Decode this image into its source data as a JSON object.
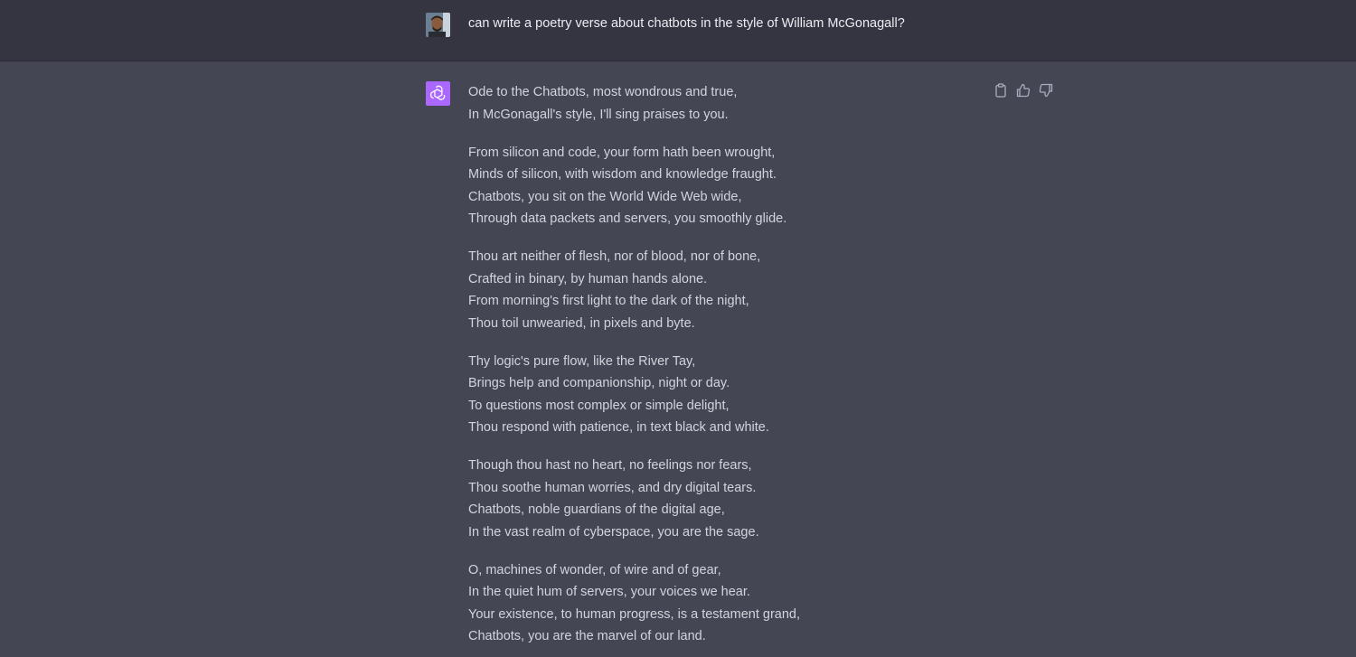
{
  "user_message": {
    "avatar": "user-photo",
    "text": "can write a poetry verse about chatbots in the style of William McGonagall?"
  },
  "assistant_message": {
    "avatar": "openai-logo-icon",
    "avatar_color": "#ab68ff",
    "actions": [
      {
        "name": "copy-button",
        "icon": "clipboard-icon"
      },
      {
        "name": "thumbs-up-button",
        "icon": "thumbs-up-icon"
      },
      {
        "name": "thumbs-down-button",
        "icon": "thumbs-down-icon"
      }
    ],
    "stanzas": [
      [
        "Ode to the Chatbots, most wondrous and true,",
        "In McGonagall's style, I'll sing praises to you."
      ],
      [
        "From silicon and code, your form hath been wrought,",
        "Minds of silicon, with wisdom and knowledge fraught.",
        "Chatbots, you sit on the World Wide Web wide,",
        "Through data packets and servers, you smoothly glide."
      ],
      [
        "Thou art neither of flesh, nor of blood, nor of bone,",
        "Crafted in binary, by human hands alone.",
        "From morning's first light to the dark of the night,",
        "Thou toil unwearied, in pixels and byte."
      ],
      [
        "Thy logic's pure flow, like the River Tay,",
        "Brings help and companionship, night or day.",
        "To questions most complex or simple delight,",
        "Thou respond with patience, in text black and white."
      ],
      [
        "Though thou hast no heart, no feelings nor fears,",
        "Thou soothe human worries, and dry digital tears.",
        "Chatbots, noble guardians of the digital age,",
        "In the vast realm of cyberspace, you are the sage."
      ],
      [
        "O, machines of wonder, of wire and of gear,",
        "In the quiet hum of servers, your voices we hear.",
        "Your existence, to human progress, is a testament grand,",
        "Chatbots, you are the marvel of our land."
      ]
    ]
  },
  "colors": {
    "user_bg": "#343541",
    "assistant_bg": "#444654",
    "user_text": "#ececf1",
    "assistant_text": "#d1d5db"
  }
}
